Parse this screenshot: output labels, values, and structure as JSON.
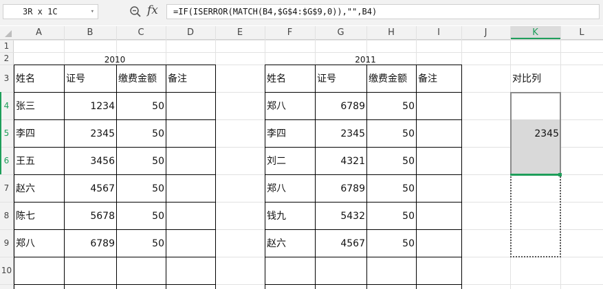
{
  "name_box": {
    "value": "3R x 1C"
  },
  "formula_bar": {
    "formula": "=IF(ISERROR(MATCH(B4,$G$4:$G$9,0)),\"\",B4)",
    "fx_label": "fx"
  },
  "columns": [
    "A",
    "B",
    "C",
    "D",
    "E",
    "F",
    "G",
    "H",
    "I",
    "J",
    "K",
    "L"
  ],
  "rows": [
    "1",
    "2",
    "3",
    "4",
    "5",
    "6",
    "7",
    "8",
    "9",
    "10"
  ],
  "selection": {
    "column": "K",
    "rows": [
      "4",
      "5",
      "6"
    ]
  },
  "table_2010": {
    "year": "2010",
    "headers": [
      "姓名",
      "证号",
      "缴费金额",
      "备注"
    ],
    "rows": [
      {
        "name": "张三",
        "id": "1234",
        "amount": "50",
        "note": ""
      },
      {
        "name": "李四",
        "id": "2345",
        "amount": "50",
        "note": ""
      },
      {
        "name": "王五",
        "id": "3456",
        "amount": "50",
        "note": ""
      },
      {
        "name": "赵六",
        "id": "4567",
        "amount": "50",
        "note": ""
      },
      {
        "name": "陈七",
        "id": "5678",
        "amount": "50",
        "note": ""
      },
      {
        "name": "郑八",
        "id": "6789",
        "amount": "50",
        "note": ""
      }
    ]
  },
  "table_2011": {
    "year": "2011",
    "headers": [
      "姓名",
      "证号",
      "缴费金额",
      "备注"
    ],
    "rows": [
      {
        "name": "郑八",
        "id": "6789",
        "amount": "50",
        "note": ""
      },
      {
        "name": "李四",
        "id": "2345",
        "amount": "50",
        "note": ""
      },
      {
        "name": "刘二",
        "id": "4321",
        "amount": "50",
        "note": ""
      },
      {
        "name": "郑八",
        "id": "6789",
        "amount": "50",
        "note": ""
      },
      {
        "name": "钱九",
        "id": "5432",
        "amount": "50",
        "note": ""
      },
      {
        "name": "赵六",
        "id": "4567",
        "amount": "50",
        "note": ""
      }
    ]
  },
  "compare_column": {
    "header": "对比列",
    "values": [
      "",
      "2345",
      "",
      "",
      "",
      ""
    ]
  },
  "colors": {
    "accent": "#1e9e5a",
    "selection": "#d9d9d9"
  }
}
